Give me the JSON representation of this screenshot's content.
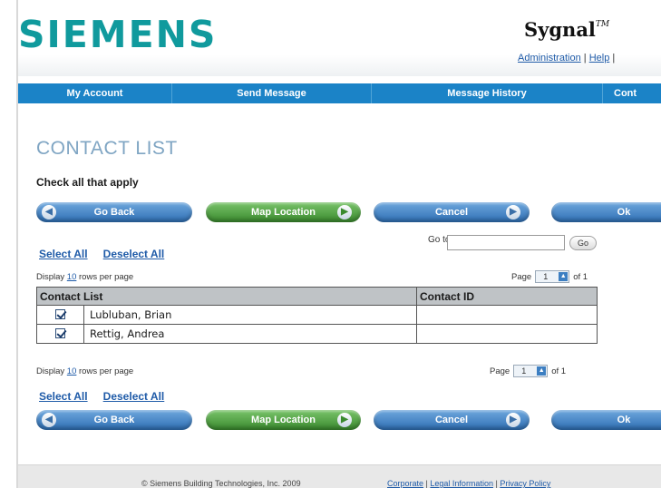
{
  "header": {
    "logo": "SIEMENS",
    "product": "Sygnal",
    "trademark": "TM",
    "links": [
      "Administration",
      "Help"
    ],
    "separator": "|"
  },
  "nav": {
    "items": [
      "My Account",
      "Send Message",
      "Message History",
      "Cont"
    ]
  },
  "page": {
    "title": "CONTACT LIST",
    "subtitle": "Check all that apply"
  },
  "buttons": {
    "go_back": "Go Back",
    "map_location": "Map Location",
    "cancel": "Cancel",
    "ok": "Ok"
  },
  "selection": {
    "select_all": "Select All",
    "deselect_all": "Deselect All"
  },
  "goto": {
    "label": "Go to",
    "value": "",
    "button": "Go"
  },
  "pagination": {
    "display_prefix": "Display",
    "rows_value": "10",
    "display_suffix": "rows per page",
    "page_label": "Page",
    "current_page": "1",
    "of_label": "of 1"
  },
  "table": {
    "columns": [
      "Contact List",
      "Contact ID"
    ],
    "rows": [
      {
        "checked": true,
        "name": "Lubluban, Brian",
        "id": ""
      },
      {
        "checked": true,
        "name": "Rettig, Andrea",
        "id": ""
      }
    ]
  },
  "footer": {
    "copyright": "© Siemens Building Technologies, Inc. 2009",
    "links": [
      "Corporate",
      "Legal Information",
      "Privacy Policy"
    ],
    "separator": "|"
  },
  "colors": {
    "brand": "#109a9d",
    "nav": "#1b83c7",
    "button_blue": "#2f6fb4",
    "button_green": "#3a8a2e",
    "title": "#7fa5c3"
  }
}
